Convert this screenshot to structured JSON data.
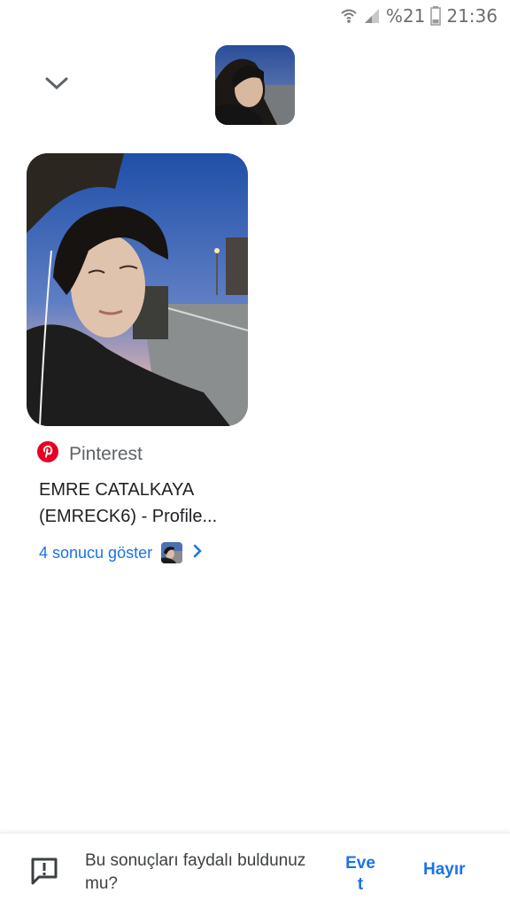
{
  "status_bar": {
    "battery_percent": "%21",
    "time": "21:36",
    "icons": [
      "wifi-icon",
      "signal-icon",
      "battery-icon"
    ]
  },
  "header": {
    "collapse_icon": "chevron-down-icon",
    "query_thumbnail_alt": "query image"
  },
  "result": {
    "source_icon": "pinterest-logo-icon",
    "source_name": "Pinterest",
    "title_line1": "EMRE CATALKAYA",
    "title_line2": "(EMRECK6) - Profile...",
    "more_label": "4 sonucu göster",
    "more_icon": "chevron-right-icon"
  },
  "feedback": {
    "question": "Bu sonuçları faydalı buldunuz mu?",
    "yes_label": "Evet",
    "no_label": "Hayır",
    "icon": "feedback-icon"
  },
  "colors": {
    "accent": "#1a73e8",
    "pinterest": "#e60023",
    "text": "#202124",
    "secondary": "#5f6368"
  }
}
